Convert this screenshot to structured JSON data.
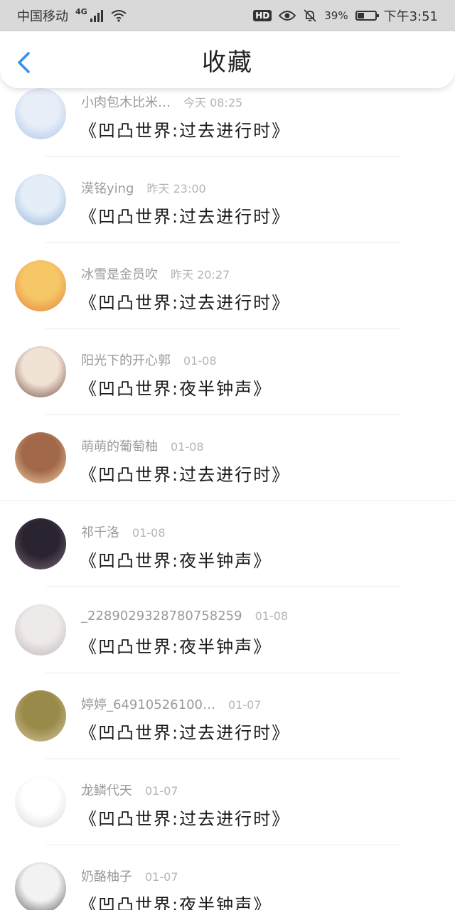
{
  "status_bar": {
    "carrier": "中国移动",
    "network": "4G",
    "battery": "39%",
    "battery_level": 0.39,
    "time": "下午3:51"
  },
  "header": {
    "title": "收藏"
  },
  "items": [
    {
      "user": "小肉包木比米…",
      "time": "今天 08:25",
      "title": "《凹凸世界:过去进行时》",
      "avatar_colors": [
        "#e7eef8",
        "#aac4e6"
      ]
    },
    {
      "user": "漠铭ying",
      "time": "昨天 23:00",
      "title": "《凹凸世界:过去进行时》",
      "avatar_colors": [
        "#e4eef8",
        "#8fb1d8"
      ]
    },
    {
      "user": "冰雪是金员吹",
      "time": "昨天 20:27",
      "title": "《凹凸世界:过去进行时》",
      "avatar_colors": [
        "#f6c766",
        "#e3813a"
      ]
    },
    {
      "user": "阳光下的开心郭",
      "time": "01-08",
      "title": "《凹凸世界:夜半钟声》",
      "avatar_colors": [
        "#f1e2d6",
        "#6f4a3b"
      ]
    },
    {
      "user": "萌萌的葡萄柚",
      "time": "01-08",
      "title": "《凹凸世界:过去进行时》",
      "avatar_colors": [
        "#a16849",
        "#f3d0a4"
      ]
    },
    {
      "user": "祁千洛",
      "time": "01-08",
      "title": "《凹凸世界:夜半钟声》",
      "avatar_colors": [
        "#2a2430",
        "#7b6a78"
      ]
    },
    {
      "user": "_2289029328780758259",
      "time": "01-08",
      "title": "《凹凸世界:夜半钟声》",
      "avatar_colors": [
        "#eeeaea",
        "#bfb2b3"
      ]
    },
    {
      "user": "婷婷_64910526100…",
      "time": "01-07",
      "title": "《凹凸世界:过去进行时》",
      "avatar_colors": [
        "#9a8a4a",
        "#d8c9a0"
      ]
    },
    {
      "user": "龙鳞代天",
      "time": "01-07",
      "title": "《凹凸世界:过去进行时》",
      "avatar_colors": [
        "#ffffff",
        "#d7d7d7"
      ]
    },
    {
      "user": "奶酪柚子",
      "time": "01-07",
      "title": "《凹凸世界:夜半钟声》",
      "avatar_colors": [
        "#f2f2f2",
        "#555555"
      ]
    }
  ]
}
